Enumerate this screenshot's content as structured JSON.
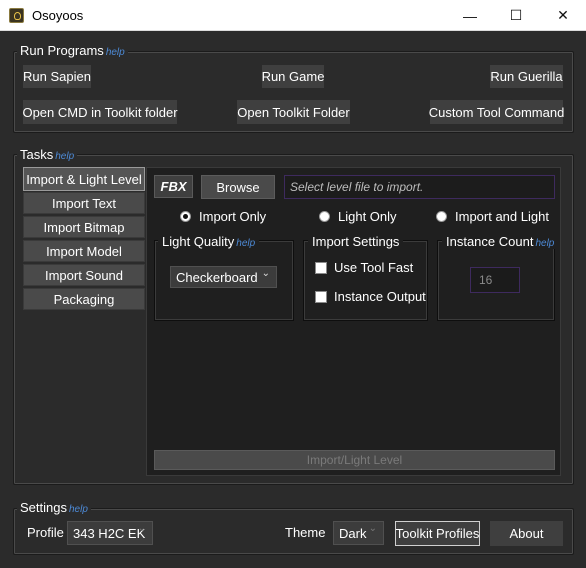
{
  "window": {
    "title": "Osoyoos",
    "minimize_glyph": "—",
    "maximize_glyph": "☐",
    "close_glyph": "✕"
  },
  "help_text": "help",
  "run_programs": {
    "title": "Run Programs",
    "run_sapien": "Run Sapien",
    "run_game": "Run Game",
    "run_guerilla": "Run Guerilla",
    "open_cmd": "Open CMD in Toolkit folder",
    "open_toolkit": "Open Toolkit Folder",
    "custom_tool": "Custom Tool Command"
  },
  "tasks": {
    "title": "Tasks",
    "tabs": [
      "Import & Light Level",
      "Import Text",
      "Import Bitmap",
      "Import Model",
      "Import Sound",
      "Packaging"
    ],
    "active_tab_index": 0,
    "fbx_label": "FBX",
    "browse_label": "Browse",
    "path_placeholder": "Select level file to import.",
    "radio_options": [
      "Import Only",
      "Light Only",
      "Import and Light"
    ],
    "radio_selected_index": 0,
    "light_quality": {
      "title": "Light Quality",
      "selected": "Checkerboard"
    },
    "import_settings": {
      "title": "Import Settings",
      "use_tool_fast": "Use Tool Fast",
      "instance_output": "Instance Output"
    },
    "instance_count": {
      "title": "Instance Count",
      "value": "16"
    },
    "run_button": "Import/Light Level"
  },
  "settings": {
    "title": "Settings",
    "profile_label": "Profile",
    "profile_value": "343 H2C EK",
    "theme_label": "Theme",
    "theme_value": "Dark",
    "toolkit_profiles": "Toolkit Profiles",
    "about": "About"
  },
  "colors": {
    "accent_help": "#4d8ad6",
    "background": "#2b2b2b",
    "panel": "#1f1f1f",
    "field_border": "#3e2a5e"
  }
}
